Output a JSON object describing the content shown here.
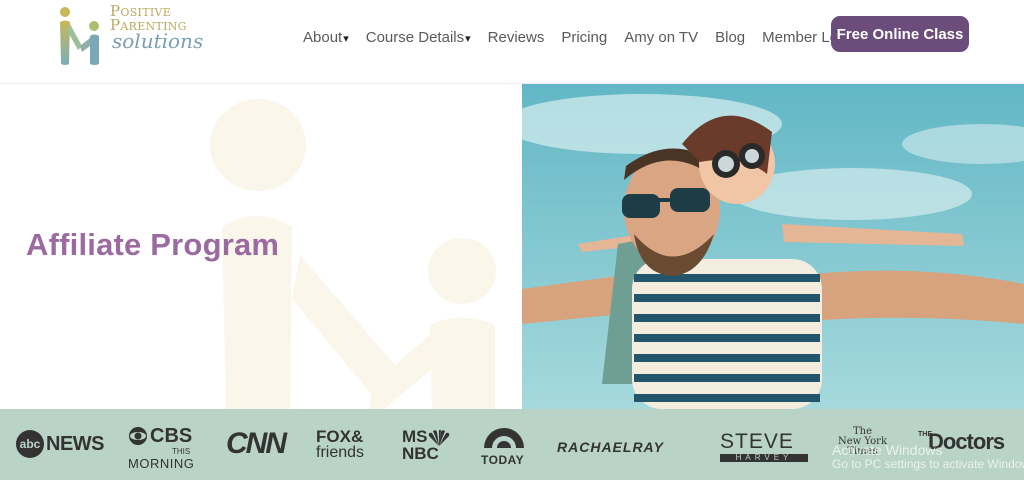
{
  "header": {
    "logo": {
      "line1": "Positive",
      "line2": "Parenting",
      "line3": "solutions"
    },
    "nav": [
      {
        "label": "About",
        "has_dropdown": true
      },
      {
        "label": "Course Details",
        "has_dropdown": true
      },
      {
        "label": "Reviews",
        "has_dropdown": false
      },
      {
        "label": "Pricing",
        "has_dropdown": false
      },
      {
        "label": "Amy on TV",
        "has_dropdown": false
      },
      {
        "label": "Blog",
        "has_dropdown": false
      },
      {
        "label": "Member Login",
        "has_dropdown": false
      }
    ],
    "caret": "▾",
    "cta_label": "Free Online Class"
  },
  "hero": {
    "title": "Affiliate Program"
  },
  "media_logos": {
    "abc": {
      "icon": "abc",
      "text": "NEWS"
    },
    "cbs": {
      "line1": "CBS",
      "line2": "THIS",
      "line3": "MORNING"
    },
    "cnn": "CNN",
    "fox": {
      "line1": "FOX&",
      "line2": "friends"
    },
    "msnbc": {
      "line1": "MS",
      "line2": "NBC"
    },
    "today": "TODAY",
    "rachael": "RACHAELRAY",
    "steve": {
      "line1": "STEVE",
      "line2": "HARVEY"
    },
    "nyt": {
      "line1": "The",
      "line2": "New York",
      "line3": "Times"
    },
    "doctors": {
      "line1": "THE",
      "line2": "Doctors"
    }
  },
  "os_watermark": {
    "line1": "Activate Windows",
    "line2": "Go to PC settings to activate Windows."
  },
  "colors": {
    "brand_purple": "#6b4c7a",
    "title_purple": "#9b6aa0",
    "logo_bar": "#b9d4c7",
    "sky": "#7fc3cc"
  }
}
